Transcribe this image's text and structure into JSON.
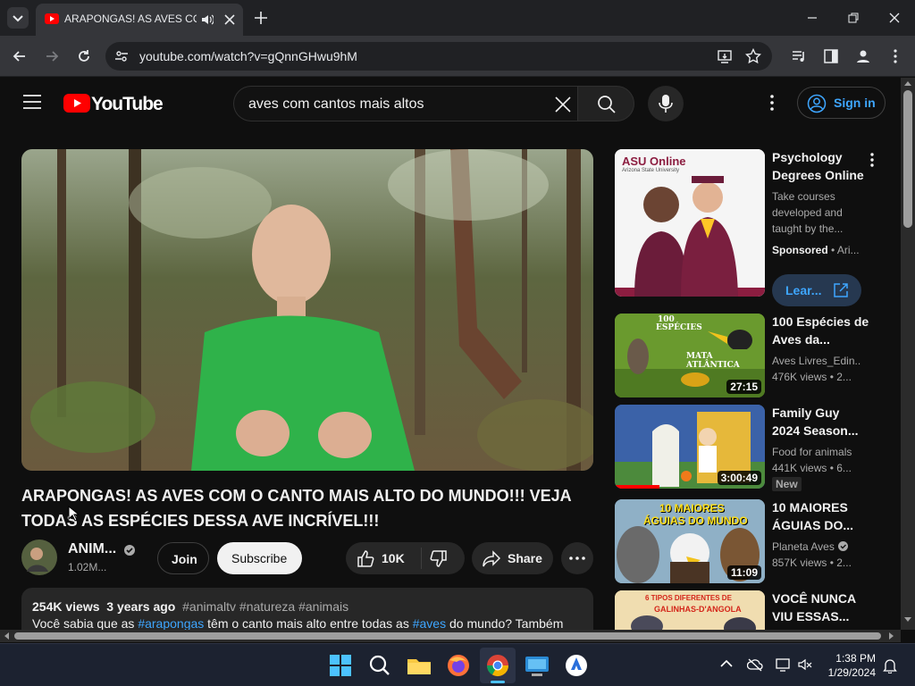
{
  "browser": {
    "tab_title": "ARAPONGAS! AS AVES COM",
    "url": "youtube.com/watch?v=gQnnGHwu9hM"
  },
  "youtube": {
    "logo_text": "YouTube",
    "search_query": "aves com cantos mais altos",
    "sign_in_label": "Sign in"
  },
  "video": {
    "title": "ARAPONGAS! AS AVES COM O CANTO MAIS ALTO DO MUNDO!!! VEJA TODAS AS ESPÉCIES DESSA AVE INCRÍVEL!!!",
    "channel_name": "ANIM...",
    "subscribers": "1.02M...",
    "join_label": "Join",
    "subscribe_label": "Subscribe",
    "likes": "10K",
    "share_label": "Share",
    "views": "254K views",
    "age": "3 years ago",
    "hashtags": "#animaltv #natureza #animais",
    "description_parts": {
      "p1": "Você sabia que as ",
      "link1": "#arapongas",
      "p2": " têm o canto mais alto entre todas as ",
      "link2": "#aves",
      "p3": " do mundo? Também"
    }
  },
  "ad": {
    "brand": "ASU Online",
    "brand_sub": "Arizona State University",
    "title": "Psychology Degrees Online",
    "description": "Take courses developed and taught by the...",
    "sponsored": "Sponsored",
    "advertiser": "Ari...",
    "cta": "Lear..."
  },
  "recommendations": [
    {
      "title": "100 Espécies de Aves da...",
      "channel": "Aves Livres_Edin...",
      "meta": "476K views • 2...",
      "duration": "27:15",
      "thumb_text_1": "100",
      "thumb_text_2": "ESPÉCIES",
      "thumb_text_3": "MATA ATLÂNTICA"
    },
    {
      "title": "Family Guy 2024 Season...",
      "channel": "Food for animals",
      "meta": "441K views • 6...",
      "duration": "3:00:49",
      "badge": "New"
    },
    {
      "title": "10 MAIORES ÁGUIAS DO...",
      "channel": "Planeta Aves",
      "meta": "857K views • 2...",
      "duration": "11:09",
      "thumb_text_1": "10 MAIORES",
      "thumb_text_2": "ÁGUIAS DO MUNDO"
    },
    {
      "title": "VOCÊ NUNCA VIU ESSAS...",
      "thumb_text_1": "6 TIPOS DIFERENTES DE",
      "thumb_text_2": "GALINHAS-D'ANGOLA"
    }
  ],
  "taskbar": {
    "time": "1:38 PM",
    "date": "1/29/2024"
  },
  "colors": {
    "yt_red": "#ff0000",
    "link_blue": "#3ea6ff",
    "background": "#0f0f0f"
  }
}
